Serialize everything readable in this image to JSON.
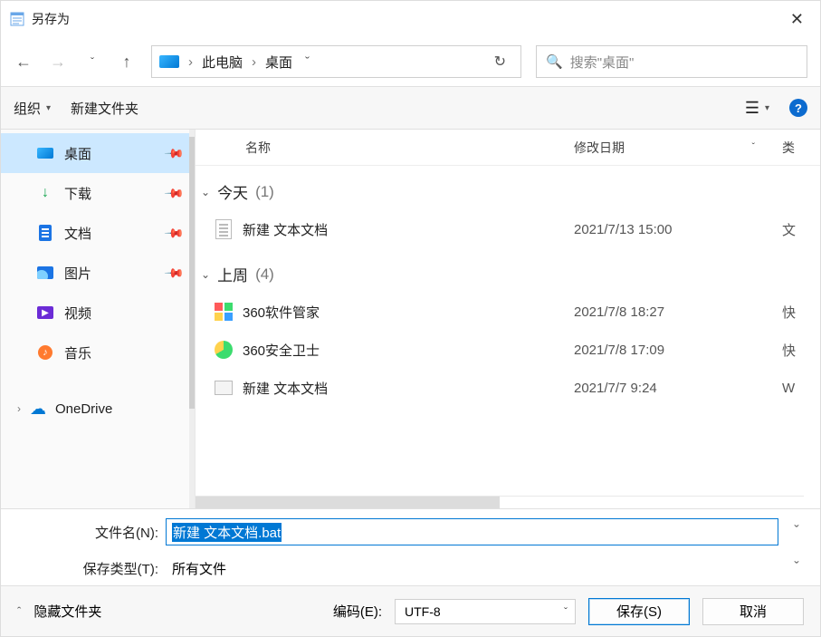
{
  "title": "另存为",
  "breadcrumb": {
    "root": "此电脑",
    "leaf": "桌面"
  },
  "search": {
    "placeholder": "搜索\"桌面\""
  },
  "toolbar": {
    "organize": "组织",
    "new_folder": "新建文件夹"
  },
  "sidebar": {
    "items": [
      {
        "label": "桌面",
        "pinned": true,
        "selected": true
      },
      {
        "label": "下载",
        "pinned": true
      },
      {
        "label": "文档",
        "pinned": true
      },
      {
        "label": "图片",
        "pinned": true
      },
      {
        "label": "视频"
      },
      {
        "label": "音乐"
      }
    ],
    "onedrive": "OneDrive"
  },
  "columns": {
    "name": "名称",
    "date": "修改日期",
    "type": "类"
  },
  "groups": [
    {
      "name": "今天",
      "count": "(1)",
      "rows": [
        {
          "icon": "txt",
          "name": "新建 文本文档",
          "date": "2021/7/13 15:00",
          "type": "文"
        }
      ]
    },
    {
      "name": "上周",
      "count": "(4)",
      "rows": [
        {
          "icon": "360a",
          "name": "360软件管家",
          "date": "2021/7/8 18:27",
          "type": "快"
        },
        {
          "icon": "360b",
          "name": "360安全卫士",
          "date": "2021/7/8 17:09",
          "type": "快"
        },
        {
          "icon": "gen",
          "name": "新建 文本文档",
          "date": "2021/7/7 9:24",
          "type": "W"
        }
      ]
    }
  ],
  "form": {
    "filename_label": "文件名(N):",
    "filename_value": "新建 文本文档.bat",
    "filetype_label": "保存类型(T):",
    "filetype_value": "所有文件"
  },
  "footer": {
    "hide_folders": "隐藏文件夹",
    "encoding_label": "编码(E):",
    "encoding_value": "UTF-8",
    "save": "保存(S)",
    "cancel": "取消"
  }
}
